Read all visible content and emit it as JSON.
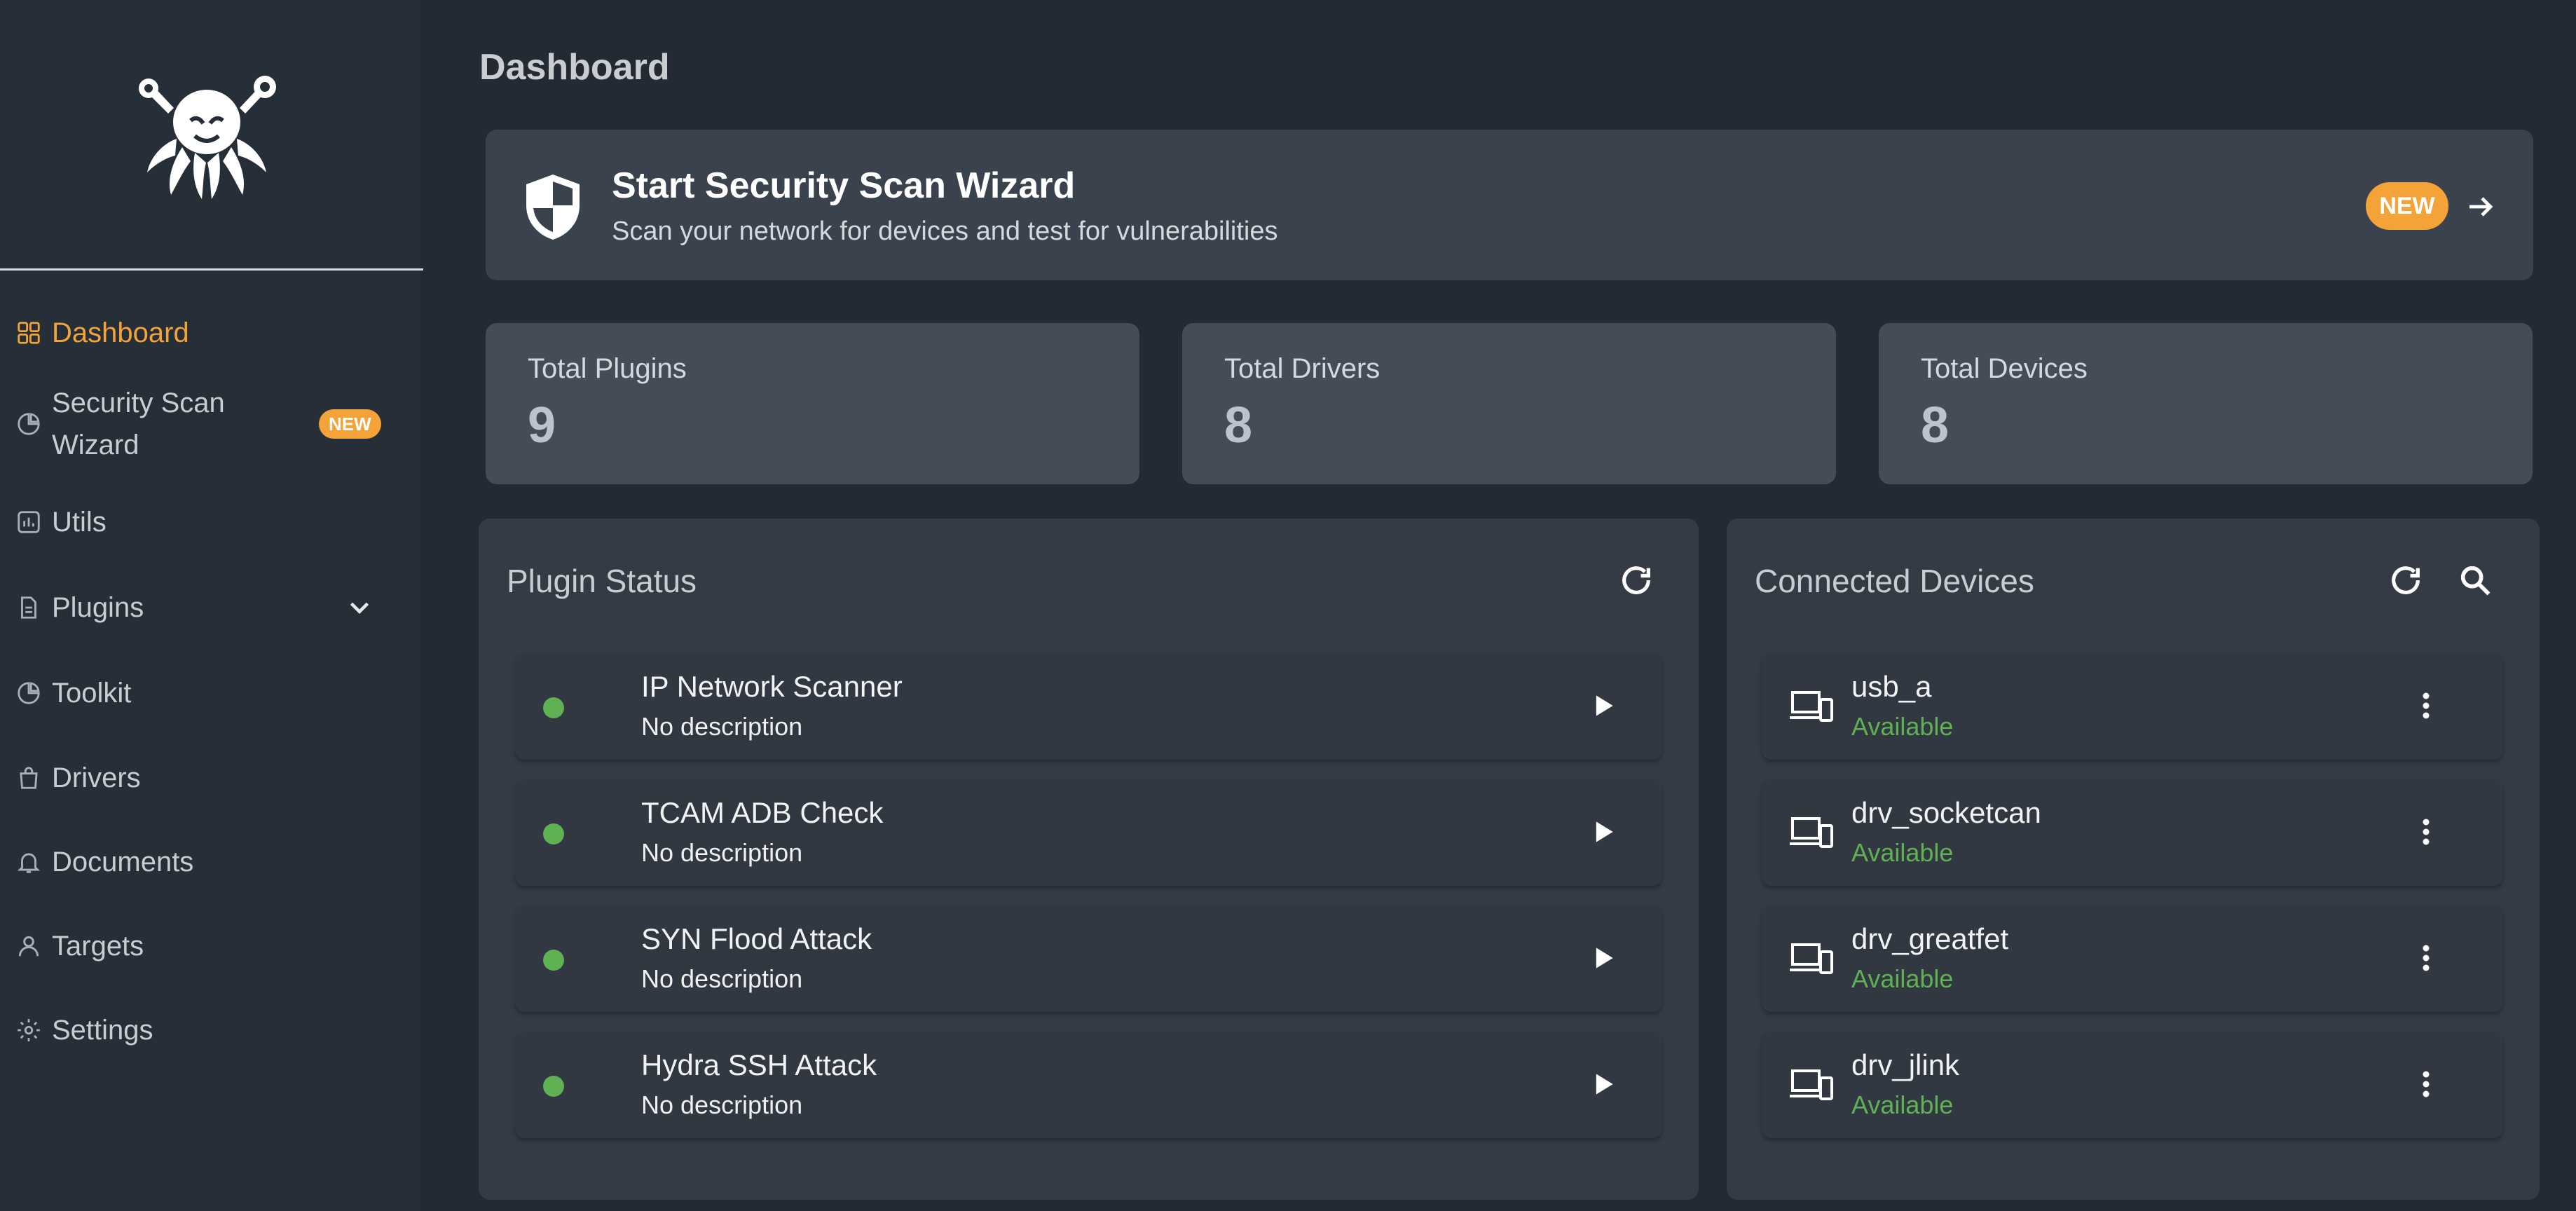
{
  "page": {
    "title": "Dashboard"
  },
  "colors": {
    "accent": "#f3a338",
    "status_green": "#5fb153",
    "available_text": "#5fb153"
  },
  "sidebar": {
    "items": [
      {
        "label": "Dashboard",
        "icon": "dashboard-grid-icon",
        "active": true
      },
      {
        "label": "Security Scan",
        "label2": "Wizard",
        "icon": "pie-chart-icon",
        "badge": "NEW"
      },
      {
        "label": "Utils",
        "icon": "bar-chart-icon"
      },
      {
        "label": "Plugins",
        "icon": "document-icon",
        "expandable": true
      },
      {
        "label": "Toolkit",
        "icon": "pie-chart-icon"
      },
      {
        "label": "Drivers",
        "icon": "shopping-bag-icon"
      },
      {
        "label": "Documents",
        "icon": "bell-icon"
      },
      {
        "label": "Targets",
        "icon": "user-icon"
      },
      {
        "label": "Settings",
        "icon": "gear-icon"
      }
    ]
  },
  "wizard": {
    "title": "Start Security Scan Wizard",
    "subtitle": "Scan your network for devices and test for vulnerabilities",
    "badge": "NEW"
  },
  "stats": [
    {
      "label": "Total Plugins",
      "value": "9"
    },
    {
      "label": "Total Drivers",
      "value": "8"
    },
    {
      "label": "Total Devices",
      "value": "8"
    }
  ],
  "plugin_status": {
    "title": "Plugin Status",
    "plugins": [
      {
        "name": "IP Network Scanner",
        "description": "No description",
        "status": "running"
      },
      {
        "name": "TCAM ADB Check",
        "description": "No description",
        "status": "running"
      },
      {
        "name": "SYN Flood Attack",
        "description": "No description",
        "status": "running"
      },
      {
        "name": "Hydra SSH Attack",
        "description": "No description",
        "status": "running"
      }
    ]
  },
  "connected_devices": {
    "title": "Connected Devices",
    "devices": [
      {
        "name": "usb_a",
        "status": "Available"
      },
      {
        "name": "drv_socketcan",
        "status": "Available"
      },
      {
        "name": "drv_greatfet",
        "status": "Available"
      },
      {
        "name": "drv_jlink",
        "status": "Available"
      }
    ]
  }
}
